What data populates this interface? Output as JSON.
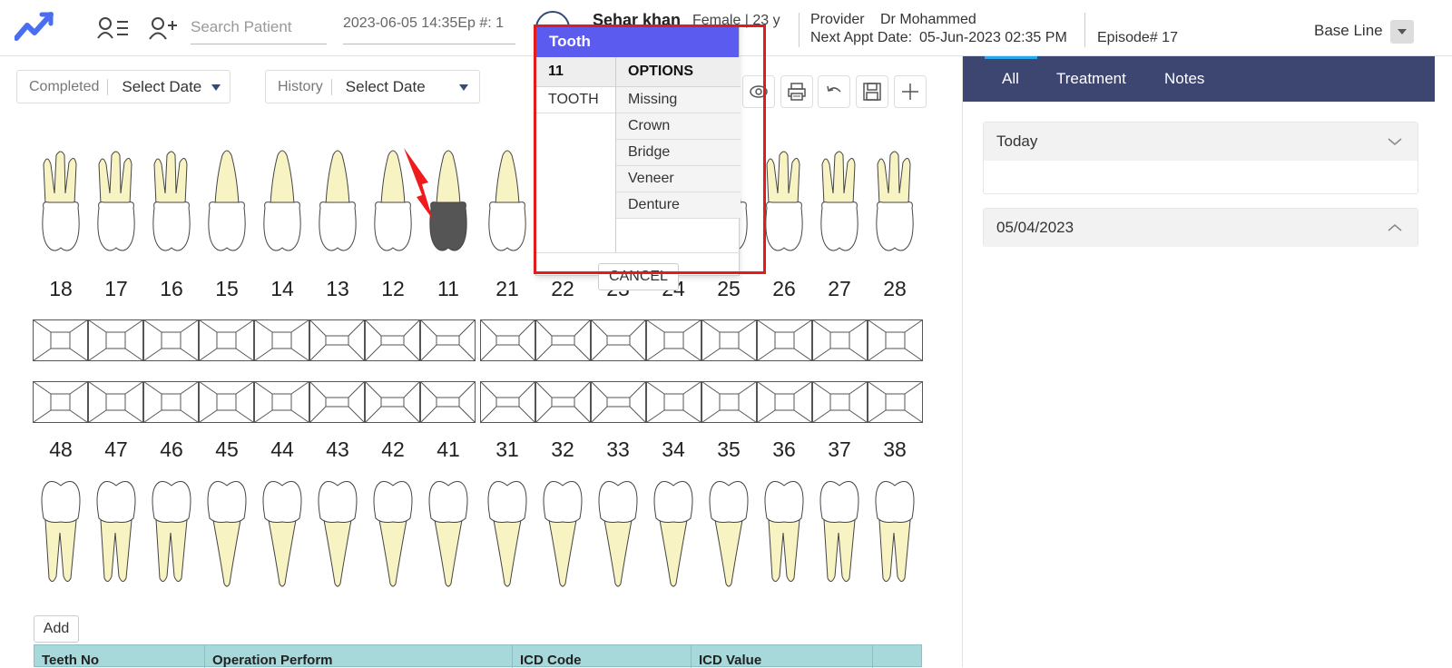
{
  "header": {
    "search_placeholder": "Search Patient",
    "datetime_episode": "2023-06-05 14:35Ep #: 1",
    "patient_name": "Sehar khan",
    "patient_meta": "Female | 23 y",
    "provider_label": "Provider",
    "provider_value": "Dr Mohammed",
    "appt_label": "Next Appt Date:",
    "appt_value": "05-Jun-2023 02:35 PM",
    "episode": "Episode# 17",
    "baseline": "Base Line"
  },
  "filters": {
    "completed_label": "Completed",
    "completed_value": "Select Date",
    "history_label": "History",
    "history_value": "Select Date"
  },
  "toolbar": [
    "eye-icon",
    "print-icon",
    "undo-icon",
    "save-icon",
    "plus-icon"
  ],
  "chart": {
    "upper_numbers": [
      "18",
      "17",
      "16",
      "15",
      "14",
      "13",
      "12",
      "11",
      "21",
      "22",
      "23",
      "24",
      "25",
      "26",
      "27",
      "28"
    ],
    "lower_numbers": [
      "48",
      "47",
      "46",
      "45",
      "44",
      "43",
      "42",
      "41",
      "31",
      "32",
      "33",
      "34",
      "35",
      "36",
      "37",
      "38"
    ],
    "selected_tooth": "11",
    "root_color": "#f7f3c3",
    "selected_color": "#555555"
  },
  "table": {
    "add_label": "Add",
    "headers": [
      "Teeth No",
      "Operation Perform",
      "ICD Code",
      "ICD Value"
    ]
  },
  "right_pane": {
    "tabs": [
      "All",
      "Treatment",
      "Notes"
    ],
    "active_tab": "All",
    "sections": [
      "Today",
      "05/04/2023"
    ]
  },
  "popup": {
    "title": "Tooth",
    "tooth_number": "11",
    "options_header": "OPTIONS",
    "type_label": "TOOTH",
    "options": [
      "Missing",
      "Crown",
      "Bridge",
      "Veneer",
      "Denture"
    ],
    "cancel_label": "CANCEL"
  }
}
